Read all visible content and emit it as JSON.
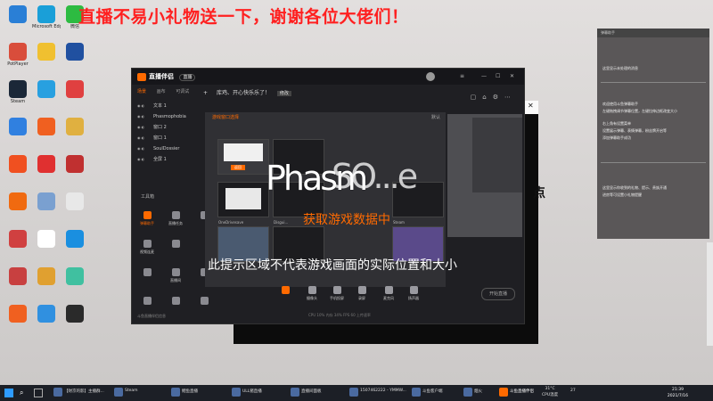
{
  "banner": "直播不易小礼物送一下，谢谢各位大佬们！",
  "desktop_icons": [
    {
      "label": "",
      "color": "#2a7fd6"
    },
    {
      "label": "Microsoft Edge",
      "color": "#1a9fd8"
    },
    {
      "label": "微信",
      "color": "#2dbb41"
    },
    {
      "label": "PotPlayer",
      "color": "#d94d3b"
    },
    {
      "label": "",
      "color": "#f0c030"
    },
    {
      "label": "",
      "color": "#2050a0"
    },
    {
      "label": "Steam",
      "color": "#1b2838"
    },
    {
      "label": "",
      "color": "#28a0e0"
    },
    {
      "label": "",
      "color": "#e04040"
    },
    {
      "label": "",
      "color": "#3080e0"
    },
    {
      "label": "",
      "color": "#f06020"
    },
    {
      "label": "",
      "color": "#e0b040"
    },
    {
      "label": "",
      "color": "#f05020"
    },
    {
      "label": "",
      "color": "#e03030"
    },
    {
      "label": "",
      "color": "#c03030"
    },
    {
      "label": "",
      "color": "#f06a10"
    },
    {
      "label": "",
      "color": "#7aa0d0"
    },
    {
      "label": "",
      "color": "#e8e8e8"
    },
    {
      "label": "",
      "color": "#d04040"
    },
    {
      "label": "",
      "color": "#ffffff"
    },
    {
      "label": "",
      "color": "#1a8fe0"
    },
    {
      "label": "",
      "color": "#c84040"
    },
    {
      "label": "",
      "color": "#e0a030"
    },
    {
      "label": "",
      "color": "#40c0a0"
    },
    {
      "label": "",
      "color": "#f06020"
    },
    {
      "label": "",
      "color": "#3090e0"
    },
    {
      "label": "",
      "color": "#2a2a2a"
    }
  ],
  "app": {
    "title": "直播伴侣",
    "mode": "直播",
    "tabs": [
      "场景",
      "画布",
      "可调试"
    ],
    "active_tab": "场景",
    "scene_title": "库鸡、开心快乐乐了！",
    "edit_label": "修改",
    "layers": [
      "文本 1",
      "Phasmophobia",
      "窗口 2",
      "窗口 1",
      "SoulDossier",
      "全屏 1"
    ],
    "tools_header": "工具箱",
    "tools_row1": [
      "弹幕助手",
      "直播任务",
      "观众",
      "直播回放"
    ],
    "tools_row2": [
      "视频连麦",
      "",
      "",
      ""
    ],
    "tools_row3": [
      "",
      "直播间",
      "",
      ""
    ],
    "panel_note": "斗鱼直播伴侣信息",
    "bottom_items": [
      "摄像头",
      "手机投屏",
      "录屏",
      "麦克风",
      "扬声器"
    ],
    "go_live": "开始直播",
    "stats": "CPU 10%  内存 34%  FPS 60  上传速率"
  },
  "modal": {
    "header": "游戏窗口选择",
    "sort": "默认",
    "tiles": [
      "返回",
      "",
      "OneDrivesave",
      "Disgui...",
      "",
      "Steam",
      "",
      "",
      ""
    ]
  },
  "overlay_text": {
    "big": "Phasm",
    "big2": "SO...e",
    "fetch": "获取游戏数据中",
    "hint": "此提示区域不代表游戏画面的实际位置和大小"
  },
  "sidepanel": {
    "header": "弹幕助手",
    "line1": "这里显示未处理的消息",
    "line2": "欢迎使用斗鱼弹幕助手",
    "line3": "左键拖拽调节弹幕位置，左键拉伸边框改变大小",
    "line4": "右上角有设置菜单",
    "line5": "设置展示弹幕、表情弹幕，粉丝牌开启等",
    "line6": "添加弹幕助手成功",
    "line7": "这里显示你收到的礼物、提示、贵族开通",
    "line8": "进房等可设置小礼物提醒"
  },
  "dot_text": "点",
  "taskbar": {
    "items": [
      "【财京的影】主播群...",
      "Steam",
      "鲤鱼直播",
      "ULL猪直播",
      "直播间面板",
      "1507462222 - YMMW...",
      "斗鱼客户端",
      "烟火",
      "斗鱼直播伴侣"
    ],
    "weather": "31°C",
    "weather_sub": "CPU温度",
    "temp2": "27",
    "time": "21:39",
    "date": "2021/7/16"
  }
}
